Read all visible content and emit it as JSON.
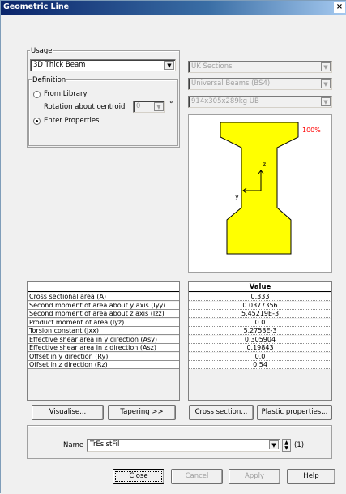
{
  "window": {
    "title": "Geometric Line",
    "close_glyph": "×"
  },
  "usage": {
    "group_label": "Usage",
    "selected": "3D Thick Beam"
  },
  "definition": {
    "group_label": "Definition",
    "from_library_label": "From Library",
    "rotation_label": "Rotation about centroid",
    "rotation_value": "0",
    "rotation_unit": "°",
    "enter_properties_label": "Enter Properties",
    "selected_option": "Enter Properties"
  },
  "library": {
    "section_type": "UK Sections",
    "section_family": "Universal Beams (BS4)",
    "section_name": "914x305x289kg UB"
  },
  "preview": {
    "zoom": "100%",
    "axis_z": "z",
    "axis_y": "y",
    "shape_color": "#ffff00",
    "zoom_color": "#ff0000"
  },
  "properties": {
    "value_header": "Value",
    "rows": [
      {
        "label": "Cross sectional area (A)",
        "value": "0.333"
      },
      {
        "label": "Second moment of area about y axis (Iyy)",
        "value": "0.0377356"
      },
      {
        "label": "Second moment of area about z axis (Izz)",
        "value": "5.45219E-3"
      },
      {
        "label": "Product moment of area (Iyz)",
        "value": "0.0"
      },
      {
        "label": "Torsion constant (Jxx)",
        "value": "5.2753E-3"
      },
      {
        "label": "Effective shear area in y direction (Asy)",
        "value": "0.305904"
      },
      {
        "label": "Effective shear area in z direction (Asz)",
        "value": "0.19843"
      },
      {
        "label": "Offset in y direction (Ry)",
        "value": "0.0"
      },
      {
        "label": "Offset in z direction (Rz)",
        "value": "0.54"
      }
    ]
  },
  "actions": {
    "visualise": "Visualise...",
    "tapering": "Tapering >>",
    "cross_section": "Cross section...",
    "plastic_properties": "Plastic properties..."
  },
  "name_field": {
    "label": "Name",
    "value": "TrEsistFil",
    "count": "(1)"
  },
  "footer": {
    "close": "Close",
    "cancel": "Cancel",
    "apply": "Apply",
    "help": "Help"
  }
}
